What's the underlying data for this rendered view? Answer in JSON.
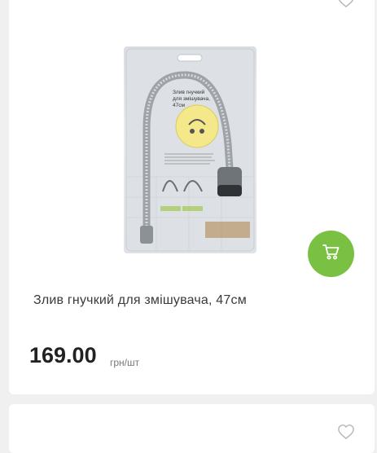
{
  "product": {
    "title": "Злив гнучкий для змішувача, 47см",
    "price": "169.00",
    "unit": "грн/шт",
    "package_label": "Злив гнучкий для змішувача, 47см"
  },
  "icons": {
    "wishlist": "heart-outline-icon",
    "cart": "shopping-cart-icon"
  },
  "colors": {
    "accent": "#7ac043",
    "card": "#ffffff",
    "background": "#f0f0f0"
  }
}
